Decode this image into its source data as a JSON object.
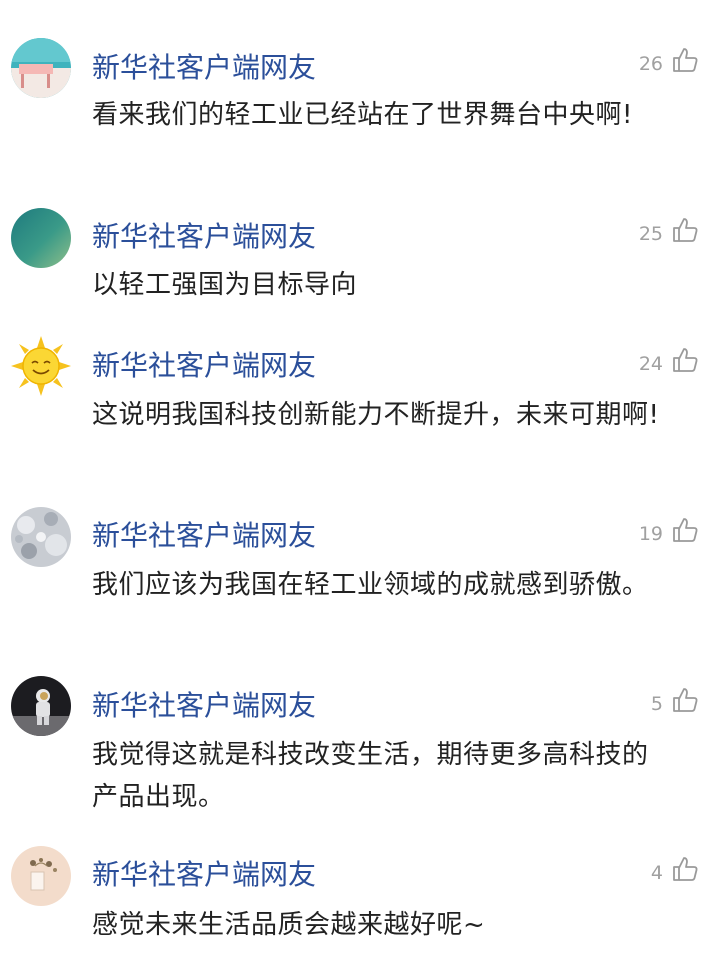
{
  "comments": [
    {
      "user": "新华社客户端网友",
      "likes": "26",
      "text": " 看来我们的轻工业已经站在了世界舞台中央啊!",
      "avatar": "beach-scene-avatar"
    },
    {
      "user": "新华社客户端网友",
      "likes": "25",
      "text": "以轻工强国为目标导向",
      "avatar": "green-gradient-avatar"
    },
    {
      "user": "新华社客户端网友",
      "likes": "24",
      "text": " 这说明我国科技创新能力不断提升，未来可期啊!",
      "avatar": "sun-smiley-avatar"
    },
    {
      "user": "新华社客户端网友",
      "likes": "19",
      "text": " 我们应该为我国在轻工业领域的成就感到骄傲。",
      "avatar": "snow-texture-avatar"
    },
    {
      "user": "新华社客户端网友",
      "likes": "5",
      "text": " 我觉得这就是科技改变生活，期待更多高科技的产品出现。",
      "avatar": "astronaut-moon-avatar"
    },
    {
      "user": "新华社客户端网友",
      "likes": "4",
      "text": " 感觉未来生活品质会越来越好呢~",
      "avatar": "beige-sketch-avatar"
    }
  ],
  "icons": {
    "like": "thumbs-up-icon"
  },
  "colors": {
    "username": "#2b4f9a",
    "text": "#222222",
    "count": "#a0a0a0"
  }
}
